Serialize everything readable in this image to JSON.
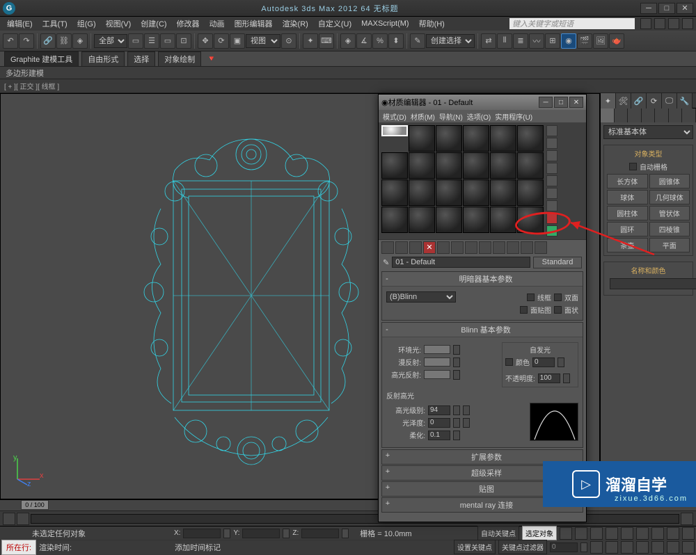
{
  "app_title": "Autodesk 3ds Max 2012    64    无标题",
  "menus": [
    "编辑(E)",
    "工具(T)",
    "组(G)",
    "视图(V)",
    "创建(C)",
    "修改器",
    "动画",
    "图形编辑器",
    "渲染(R)",
    "自定义(U)",
    "MAXScript(M)",
    "帮助(H)"
  ],
  "search_placeholder": "键入关键字或短语",
  "toolbar_view_sel": "视图",
  "toolbar_scope": "全部",
  "toolbar_selset": "创建选择集",
  "ribbon": {
    "main": "Graphite 建模工具",
    "tabs": [
      "自由形式",
      "选择",
      "对象绘制"
    ]
  },
  "sub_ribbon": "多边形建模",
  "viewport_label": "[ + ][ 正交 ][ 线框 ]",
  "timeline_pos": "0 / 100",
  "material_editor": {
    "title": "材质编辑器 - 01 - Default",
    "menus": [
      "模式(D)",
      "材质(M)",
      "导航(N)",
      "选项(O)",
      "实用程序(U)"
    ],
    "mat_name": "01 - Default",
    "type_btn": "Standard",
    "shader_ro": "明暗器基本参数",
    "shader": "(B)Blinn",
    "wire": "线框",
    "twoside": "双面",
    "facemap": "面贴图",
    "faceted": "面状",
    "blinn_ro": "Blinn 基本参数",
    "selfillum_grp": "自发光",
    "color_chk": "颜色",
    "selfillum_val": "0",
    "ambient": "环境光:",
    "diffuse": "漫反射:",
    "specular": "高光反射:",
    "opacity": "不透明度:",
    "opacity_val": "100",
    "spec_hl": "反射高光",
    "spec_level": "高光级别:",
    "spec_level_val": "94",
    "gloss": "光泽度:",
    "gloss_val": "0",
    "soften": "柔化:",
    "soften_val": "0.1",
    "closed": [
      "扩展参数",
      "超级采样",
      "贴图",
      "mental ray 连接"
    ]
  },
  "cmd": {
    "dropdown": "标准基本体",
    "obj_type": "对象类型",
    "autogrid": "自动栅格",
    "prims": [
      "长方体",
      "圆锥体",
      "球体",
      "几何球体",
      "圆柱体",
      "管状体",
      "圆环",
      "四棱锥",
      "茶壶",
      "平面"
    ],
    "name_color": "名称和颜色"
  },
  "status": {
    "none": "未选定任何对象",
    "x": "X:",
    "y": "Y:",
    "z": "Z:",
    "grid": "栅格 = 10.0mm",
    "auto_key": "自动关键点",
    "sel_key": "选定对象",
    "loc": "所在行:",
    "render_time": "渲染时间:",
    "add_time": "添加时间标记",
    "set_key": "设置关键点",
    "key_filter": "关键点过滤器"
  },
  "watermark": {
    "brand": "溜溜自学",
    "sub": "zixue.3d66.com"
  }
}
